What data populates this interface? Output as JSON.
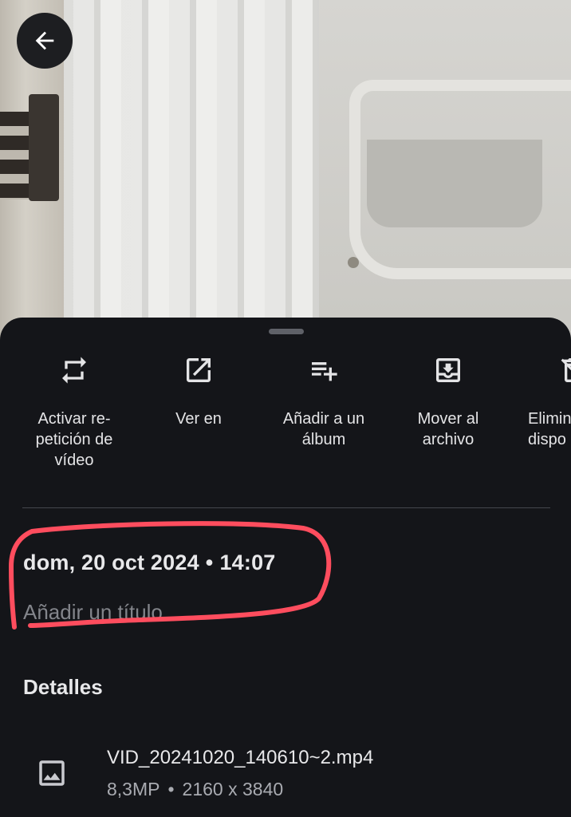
{
  "back_button": {
    "icon": "arrow-left-icon"
  },
  "actions": [
    {
      "icon": "repeat-icon",
      "label": "Activar re-\npetición de\nvídeo"
    },
    {
      "icon": "open-external-icon",
      "label": "Ver en"
    },
    {
      "icon": "playlist-add-icon",
      "label": "Añadir a un\nálbum"
    },
    {
      "icon": "archive-icon",
      "label": "Mover al\narchivo"
    },
    {
      "icon": "delete-device-icon",
      "label": "Elimin\ndispo"
    }
  ],
  "info": {
    "date": "dom, 20 oct 2024",
    "separator": "•",
    "time": "14:07",
    "title_placeholder": "Añadir un título..."
  },
  "details": {
    "heading": "Detalles",
    "file": {
      "icon": "image-icon",
      "name": "VID_20241020_140610~2.mp4",
      "megapixels": "8,3MP",
      "separator": "•",
      "resolution": "2160 x 3840"
    }
  },
  "colors": {
    "sheet_background": "#141519",
    "annotation": "#ff4d5e"
  }
}
